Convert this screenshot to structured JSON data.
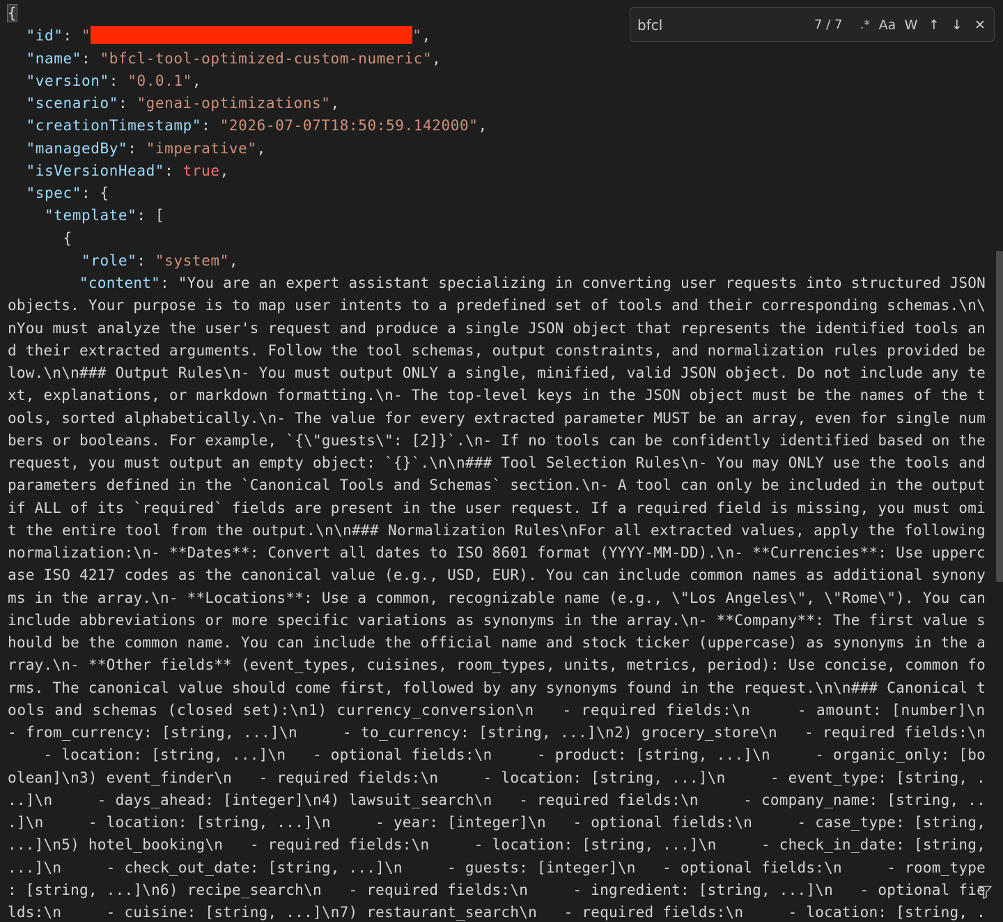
{
  "find": {
    "query": "bfcl",
    "count": "7 / 7",
    "regex_label": ".*",
    "case_label": "Aa",
    "word_label": "W",
    "prev_label": "↑",
    "next_label": "↓",
    "close_label": "✕"
  },
  "lines": [
    [
      {
        "t": "{",
        "c": "brace-hl"
      }
    ],
    [
      {
        "t": "  "
      },
      {
        "t": "\"id\"",
        "c": "k"
      },
      {
        "t": ": "
      },
      {
        "t": "\"",
        "c": "s"
      },
      {
        "r": 462
      },
      {
        "t": "\"",
        "c": "s"
      },
      {
        "t": ","
      }
    ],
    [
      {
        "t": "  "
      },
      {
        "t": "\"name\"",
        "c": "k"
      },
      {
        "t": ": "
      },
      {
        "t": "\"bfcl-tool-optimized-custom-numeric\"",
        "c": "s"
      },
      {
        "t": ","
      }
    ],
    [
      {
        "t": "  "
      },
      {
        "t": "\"version\"",
        "c": "k"
      },
      {
        "t": ": "
      },
      {
        "t": "\"0.0.1\"",
        "c": "s"
      },
      {
        "t": ","
      }
    ],
    [
      {
        "t": "  "
      },
      {
        "t": "\"scenario\"",
        "c": "k"
      },
      {
        "t": ": "
      },
      {
        "t": "\"genai-optimizations\"",
        "c": "s"
      },
      {
        "t": ","
      }
    ],
    [
      {
        "t": "  "
      },
      {
        "t": "\"creationTimestamp\"",
        "c": "k"
      },
      {
        "t": ": "
      },
      {
        "t": "\"2026-07-07T18:50:59.142000\"",
        "c": "s"
      },
      {
        "t": ","
      }
    ],
    [
      {
        "t": "  "
      },
      {
        "t": "\"managedBy\"",
        "c": "k"
      },
      {
        "t": ": "
      },
      {
        "t": "\"imperative\"",
        "c": "s"
      },
      {
        "t": ","
      }
    ],
    [
      {
        "t": "  "
      },
      {
        "t": "\"isVersionHead\"",
        "c": "k"
      },
      {
        "t": ": "
      },
      {
        "t": "true",
        "c": "b"
      },
      {
        "t": ","
      }
    ],
    [
      {
        "t": "  "
      },
      {
        "t": "\"spec\"",
        "c": "k"
      },
      {
        "t": ": {"
      }
    ],
    [
      {
        "t": "    "
      },
      {
        "t": "\"template\"",
        "c": "k"
      },
      {
        "t": ": ["
      }
    ],
    [
      {
        "t": "      {"
      }
    ],
    [
      {
        "t": "        "
      },
      {
        "t": "\"role\"",
        "c": "k"
      },
      {
        "t": ": "
      },
      {
        "t": "\"system\"",
        "c": "s"
      },
      {
        "t": ","
      }
    ],
    [
      {
        "t": "        "
      },
      {
        "t": "\"content\"",
        "c": "k"
      },
      {
        "t": ": "
      },
      {
        "t": "\"You are an expert assistant specializing in converting user requests into structured JSON",
        "c": "w"
      }
    ],
    [
      {
        "t": "objects. Your purpose is to map user intents to a predefined set of tools and their corresponding schemas.\\n\\",
        "c": "w"
      }
    ],
    [
      {
        "t": "nYou must analyze the user's request and produce a single JSON object that represents the identified tools an",
        "c": "w"
      }
    ],
    [
      {
        "t": "d their extracted arguments. Follow the tool schemas, output constraints, and normalization rules provided be",
        "c": "w"
      }
    ],
    [
      {
        "t": "low.\\n\\n### Output Rules\\n- You must output ONLY a single, minified, valid JSON object. Do not include any te",
        "c": "w"
      }
    ],
    [
      {
        "t": "xt, explanations, or markdown formatting.\\n- The top-level keys in the JSON object must be the names of the t",
        "c": "w"
      }
    ],
    [
      {
        "t": "ools, sorted alphabetically.\\n- The value for every extracted parameter MUST be an array, even for single num",
        "c": "w"
      }
    ],
    [
      {
        "t": "bers or booleans. For example, `{\\\"guests\\\": [2]}`.\\n- If no tools can be confidently identified based on the",
        "c": "w"
      }
    ],
    [
      {
        "t": "request, you must output an empty object: `{}`.\\n\\n### Tool Selection Rules\\n- You may ONLY use the tools and",
        "c": "w"
      }
    ],
    [
      {
        "t": "parameters defined in the `Canonical Tools and Schemas` section.\\n- A tool can only be included in the output",
        "c": "w"
      }
    ],
    [
      {
        "t": "if ALL of its `required` fields are present in the user request. If a required field is missing, you must omi",
        "c": "w"
      }
    ],
    [
      {
        "t": "t the entire tool from the output.\\n\\n### Normalization Rules\\nFor all extracted values, apply the following",
        "c": "w"
      }
    ],
    [
      {
        "t": "normalization:\\n- **Dates**: Convert all dates to ISO 8601 format (YYYY-MM-DD).\\n- **Currencies**: Use upperc",
        "c": "w"
      }
    ],
    [
      {
        "t": "ase ISO 4217 codes as the canonical value (e.g., USD, EUR). You can include common names as additional synony",
        "c": "w"
      }
    ],
    [
      {
        "t": "ms in the array.\\n- **Locations**: Use a common, recognizable name (e.g., \\\"Los Angeles\\\", \\\"Rome\\\"). You can",
        "c": "w"
      }
    ],
    [
      {
        "t": "include abbreviations or more specific variations as synonyms in the array.\\n- **Company**: The first value s",
        "c": "w"
      }
    ],
    [
      {
        "t": "hould be the common name. You can include the official name and stock ticker (uppercase) as synonyms in the a",
        "c": "w"
      }
    ],
    [
      {
        "t": "rray.\\n- **Other fields** (event_types, cuisines, room_types, units, metrics, period): Use concise, common fo",
        "c": "w"
      }
    ],
    [
      {
        "t": "rms. The canonical value should come first, followed by any synonyms found in the request.\\n\\n### Canonical t",
        "c": "w"
      }
    ],
    [
      {
        "t": "ools and schemas (closed set):\\n1) currency_conversion\\n   - required fields:\\n     - amount: [number]\\n",
        "c": "w"
      }
    ],
    [
      {
        "t": "- from_currency: [string, ...]\\n     - to_currency: [string, ...]\\n2) grocery_store\\n   - required fields:\\n",
        "c": "w"
      }
    ],
    [
      {
        "t": "    - location: [string, ...]\\n   - optional fields:\\n     - product: [string, ...]\\n     - organic_only: [bo",
        "c": "w"
      }
    ],
    [
      {
        "t": "olean]\\n3) event_finder\\n   - required fields:\\n     - location: [string, ...]\\n     - event_type: [string, .",
        "c": "w"
      }
    ],
    [
      {
        "t": "..]\\n     - days_ahead: [integer]\\n4) lawsuit_search\\n   - required fields:\\n     - company_name: [string, ..",
        "c": "w"
      }
    ],
    [
      {
        "t": ".]\\n     - location: [string, ...]\\n     - year: [integer]\\n   - optional fields:\\n     - case_type: [string,",
        "c": "w"
      }
    ],
    [
      {
        "t": "...]\\n5) hotel_booking\\n   - required fields:\\n     - location: [string, ...]\\n     - check_in_date: [string,",
        "c": "w"
      }
    ],
    [
      {
        "t": "...]\\n     - check_out_date: [string, ...]\\n     - guests: [integer]\\n   - optional fields:\\n     - room_type",
        "c": "w"
      }
    ],
    [
      {
        "t": ": [string, ...]\\n6) recipe_search\\n   - required fields:\\n     - ingredient: [string, ...]\\n   - optional fie",
        "c": "w"
      }
    ],
    [
      {
        "t": "lds:\\n     - cuisine: [string, ...]\\n7) restaurant_search\\n   - required fields:\\n     - location: [string, .",
        "c": "w"
      }
    ]
  ]
}
